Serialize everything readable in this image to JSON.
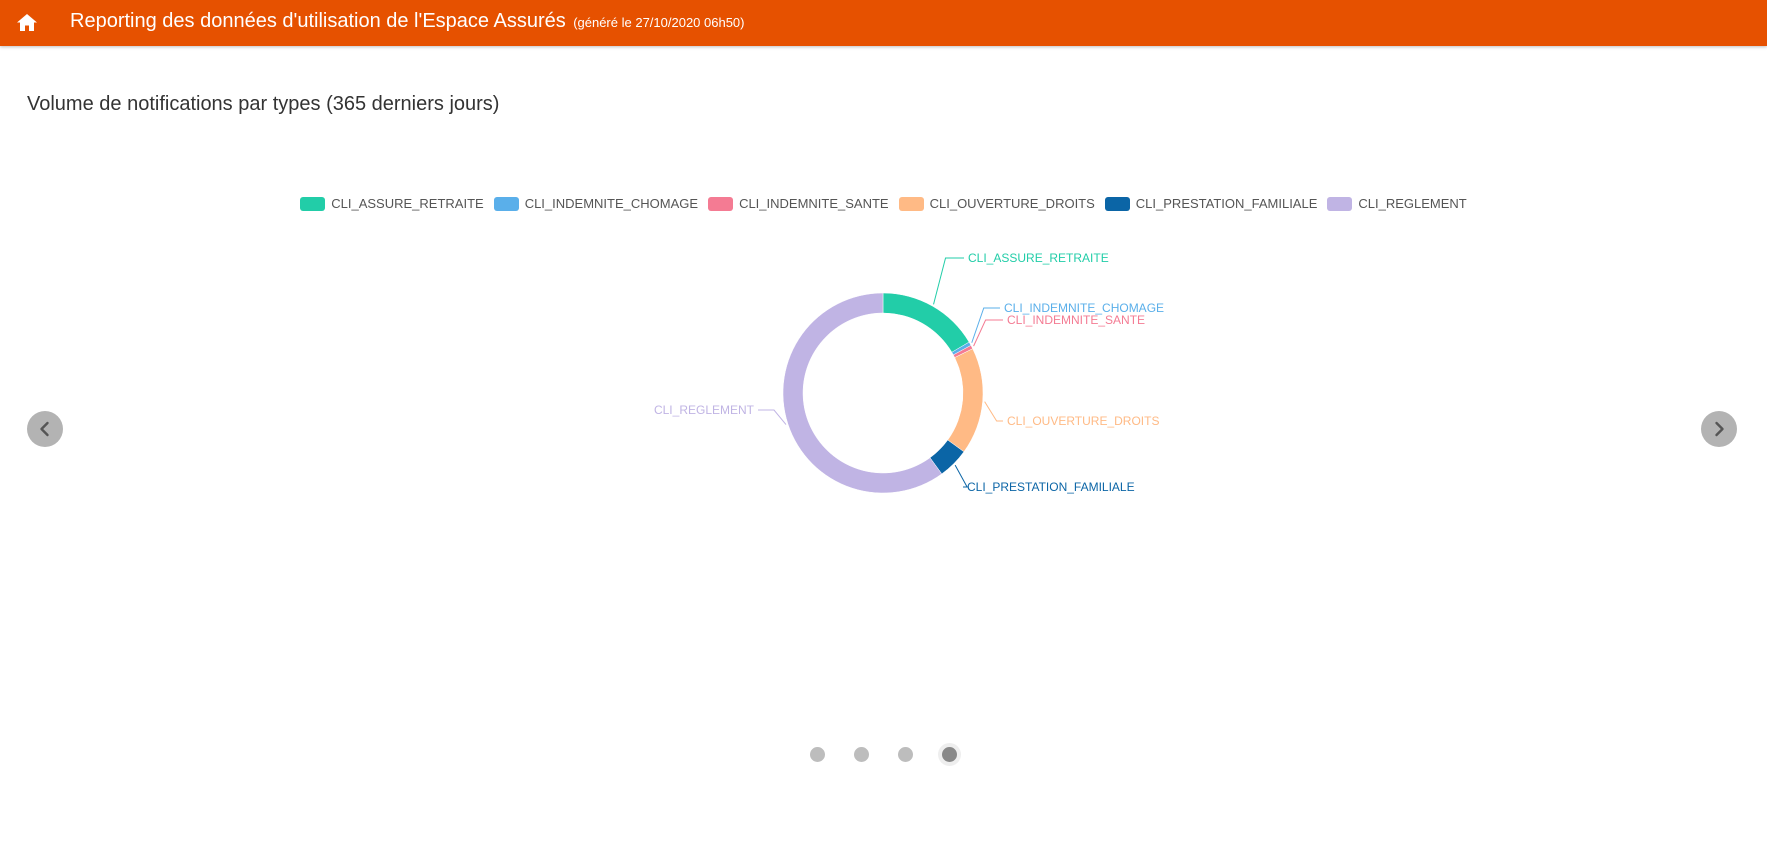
{
  "header": {
    "title": "Reporting des données d'utilisation de l'Espace Assurés",
    "subtitle": "(généré le 27/10/2020 06h50)",
    "background": "#e65100",
    "home_icon": "home-icon"
  },
  "chart_heading": "Volume de notifications par types (365 derniers jours)",
  "chart_data": {
    "type": "pie",
    "donut": true,
    "legend_position": "top",
    "categories": [
      "CLI_ASSURE_RETRAITE",
      "CLI_INDEMNITE_CHOMAGE",
      "CLI_INDEMNITE_SANTE",
      "CLI_OUVERTURE_DROITS",
      "CLI_PRESTATION_FAMILIALE",
      "CLI_REGLEMENT"
    ],
    "values": [
      16.5,
      0.6,
      0.6,
      17.3,
      5.0,
      60.0
    ],
    "colors": [
      "#22cda8",
      "#5aafea",
      "#f47b93",
      "#ffba85",
      "#0b65a6",
      "#c0b4e4"
    ]
  },
  "carousel": {
    "prev_icon": "chevron-left-icon",
    "next_icon": "chevron-right-icon",
    "page_count": 4,
    "active_index": 3
  }
}
